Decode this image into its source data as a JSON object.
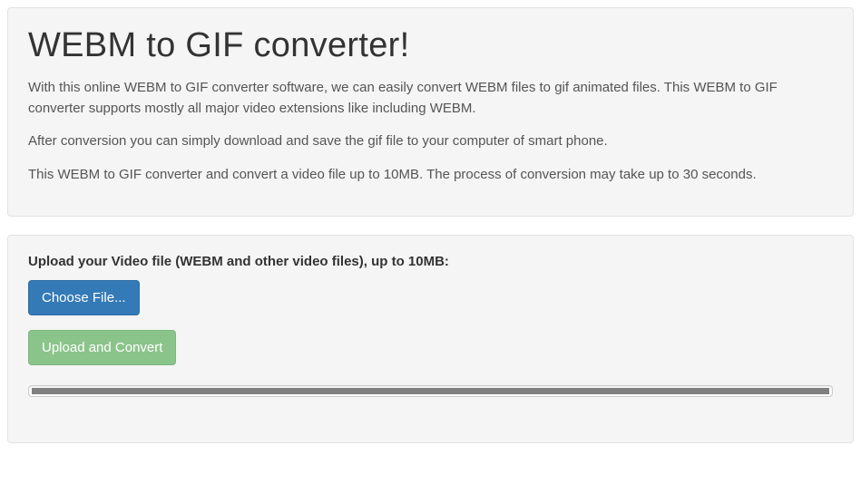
{
  "intro": {
    "title": "WEBM to GIF converter!",
    "p1": "With this online WEBM to GIF converter software, we can easily convert WEBM files to gif animated files. This WEBM to GIF converter supports mostly all major video extensions like including WEBM.",
    "p2": "After conversion you can simply download and save the gif file to your computer of smart phone.",
    "p3": "This WEBM to GIF converter and convert a video file up to 10MB. The process of conversion may take up to 30 seconds."
  },
  "upload": {
    "label": "Upload your Video file (WEBM and other video files), up to 10MB:",
    "choose_label": "Choose File...",
    "convert_label": "Upload and Convert",
    "progress_percent": 100
  }
}
